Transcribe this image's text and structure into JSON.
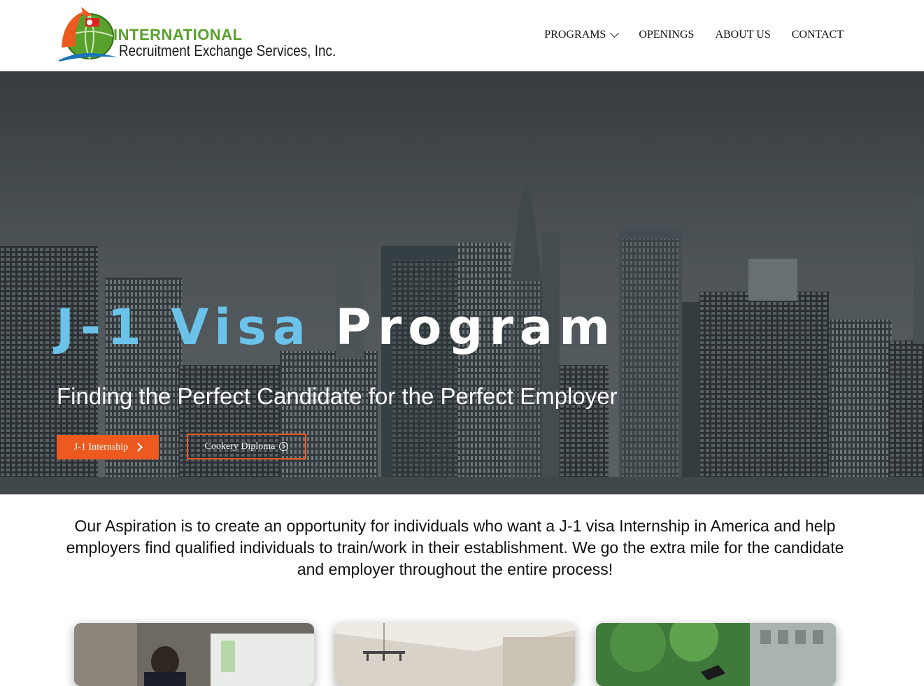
{
  "brand": {
    "line1": "INTERNATIONAL",
    "line2": "Recruitment Exchange Services, Inc.",
    "colors": {
      "green": "#5aa02c",
      "orange": "#ec5a20",
      "blue": "#1b75bb"
    }
  },
  "nav": {
    "items": [
      {
        "label": "PROGRAMS",
        "has_dropdown": true
      },
      {
        "label": "OPENINGS"
      },
      {
        "label": "ABOUT US"
      },
      {
        "label": "CONTACT"
      }
    ]
  },
  "hero": {
    "title_part1": "J-1 Visa",
    "title_part2": "Program",
    "subtitle": "Finding the Perfect Candidate for the Perfect Employer",
    "button_primary": "J-1 Internship",
    "button_secondary": "Cookery Diploma",
    "accent": "#6cc3ea"
  },
  "intro": {
    "text": "Our Aspiration is to create an opportunity for individuals who want a J-1 visa Internship in America and help employers find qualified individuals to train/work in their establishment. We go the extra mile for the candidate and employer throughout the entire process!"
  },
  "cards": [
    {
      "image": "office-photo"
    },
    {
      "image": "interior-photo"
    },
    {
      "image": "garden-photo"
    }
  ]
}
